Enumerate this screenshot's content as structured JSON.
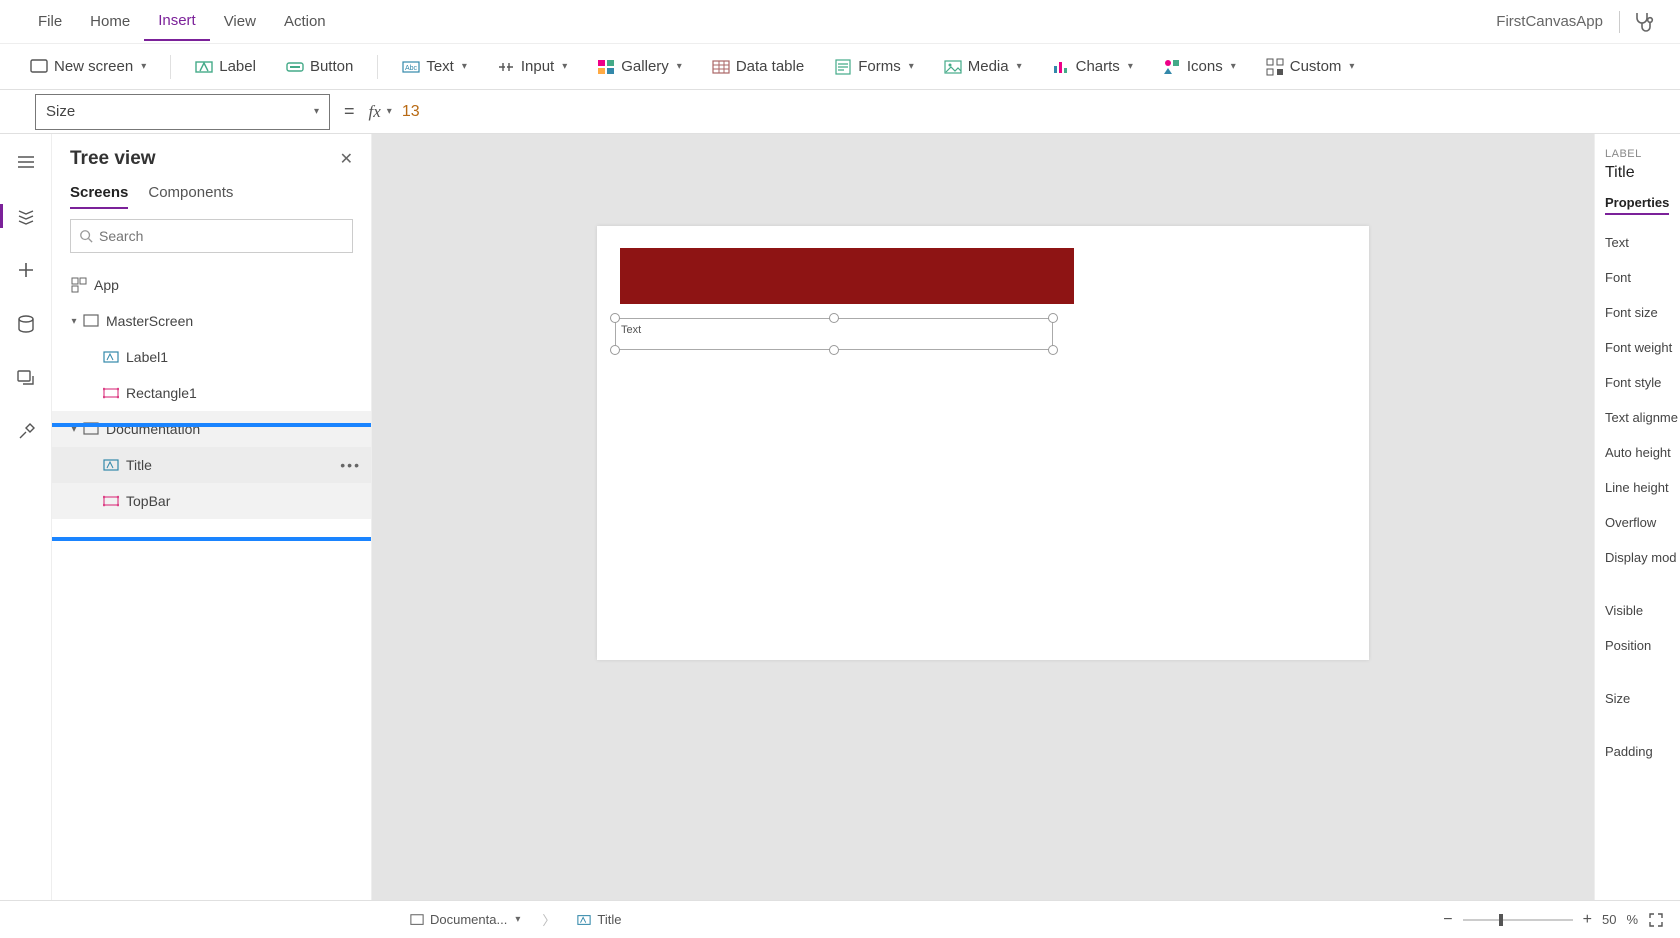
{
  "menubar": {
    "items": [
      "File",
      "Home",
      "Insert",
      "View",
      "Action"
    ],
    "active": "Insert",
    "appName": "FirstCanvasApp"
  },
  "ribbon": {
    "newscreen": "New screen",
    "label": "Label",
    "button": "Button",
    "text": "Text",
    "input": "Input",
    "gallery": "Gallery",
    "datatable": "Data table",
    "forms": "Forms",
    "media": "Media",
    "charts": "Charts",
    "icons": "Icons",
    "custom": "Custom"
  },
  "formula": {
    "property": "Size",
    "value": "13"
  },
  "tree": {
    "title": "Tree view",
    "tabs": [
      "Screens",
      "Components"
    ],
    "activeTab": "Screens",
    "searchPlaceholder": "Search",
    "app": "App",
    "screen1": "MasterScreen",
    "screen1_children": [
      "Label1",
      "Rectangle1"
    ],
    "screen2": "Documentation",
    "screen2_children": [
      "Title",
      "TopBar"
    ]
  },
  "canvas": {
    "labelText": "Text"
  },
  "props": {
    "type": "LABEL",
    "name": "Title",
    "tab": "Properties",
    "rows": [
      "Text",
      "Font",
      "Font size",
      "Font weight",
      "Font style",
      "Text alignme",
      "Auto height",
      "Line height",
      "Overflow",
      "Display mod",
      "Visible",
      "Position",
      "Size",
      "Padding"
    ]
  },
  "status": {
    "breadcrumb1": "Documenta...",
    "breadcrumb2": "Title",
    "zoom": "50",
    "zoomUnit": "%"
  }
}
